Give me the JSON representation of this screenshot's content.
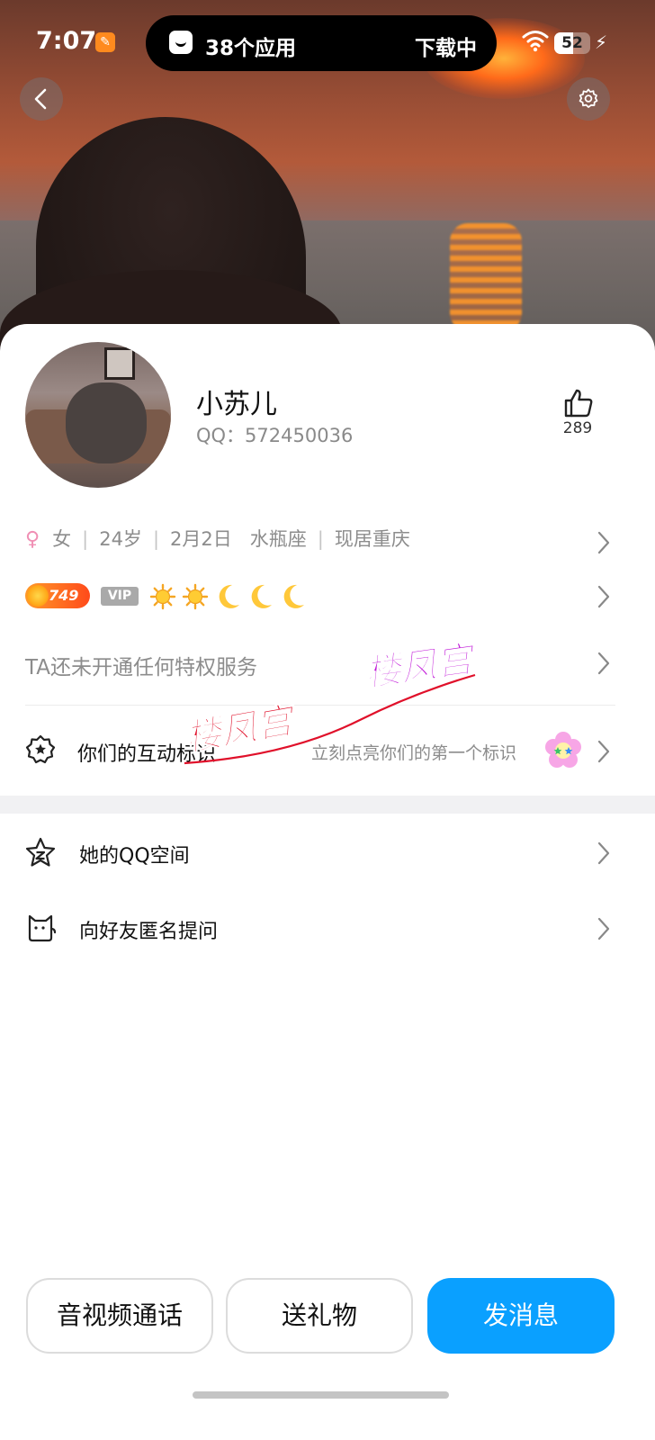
{
  "status_bar": {
    "time": "7:07",
    "island_left": "38个应用",
    "island_right": "下载中",
    "battery_level": "52",
    "battery_fraction": 0.52
  },
  "profile": {
    "name": "小苏儿",
    "qq": "QQ：572450036",
    "likes": "289"
  },
  "info": {
    "gender_symbol": "♀",
    "gender": "女",
    "age": "24岁",
    "birthday": "2月2日",
    "zodiac": "水瓶座",
    "location": "现居重庆",
    "separator": "|"
  },
  "badges": {
    "coin_value": "749",
    "vip_label": "VIP",
    "level_icons": [
      "sun-icon",
      "sun-icon",
      "moon-icon",
      "moon-icon",
      "moon-icon"
    ]
  },
  "privilege_text": "TA还未开通任何特权服务",
  "interaction": {
    "label": "你们的互动标识",
    "hint": "立刻点亮你们的第一个标识"
  },
  "menu": [
    {
      "label": "她的QQ空间",
      "icon": "qzone-star-icon"
    },
    {
      "label": "向好友匿名提问",
      "icon": "anonymous-cat-icon"
    }
  ],
  "watermark": {
    "text_1": "楼凤宫",
    "text_2": "楼凤宫"
  },
  "actions": {
    "call": "音视频通话",
    "gift": "送礼物",
    "message": "发消息"
  },
  "colors": {
    "accent": "#0aa0ff",
    "female": "#f08fb4",
    "coin_badge": "#ff5a1a",
    "watermark_red": "#e0102a",
    "watermark_purple": "#c016d8"
  }
}
